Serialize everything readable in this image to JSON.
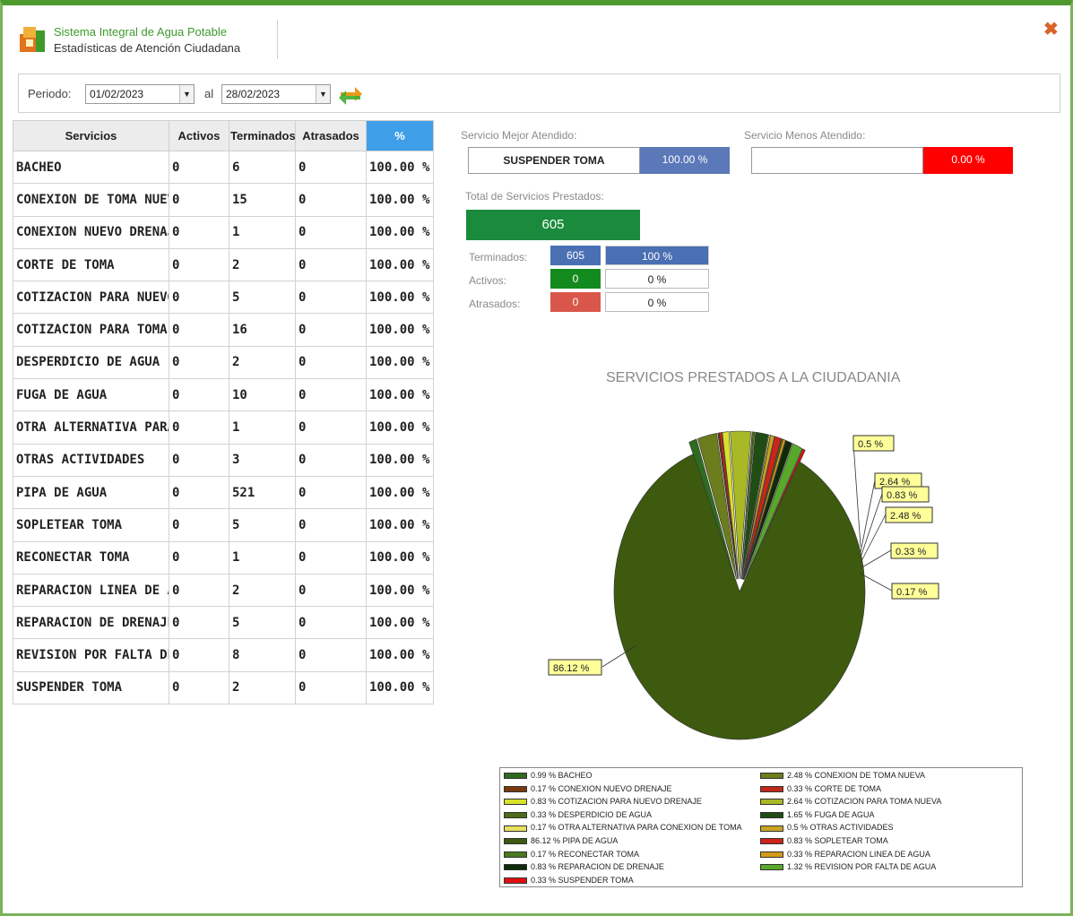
{
  "app": {
    "title": "Sistema Integral de Agua Potable",
    "subtitle": "Estadísticas de Atención Ciudadana"
  },
  "filter": {
    "periodo_label": "Periodo:",
    "from_date": "01/02/2023",
    "al_label": "al",
    "to_date": "28/02/2023"
  },
  "table": {
    "headers": [
      "Servicios",
      "Activos",
      "Terminados",
      "Atrasados",
      "%"
    ],
    "rows": [
      [
        "BACHEO",
        "0",
        "6",
        "0",
        "100.00 %"
      ],
      [
        "CONEXION DE TOMA NUEVA",
        "0",
        "15",
        "0",
        "100.00 %"
      ],
      [
        "CONEXION NUEVO DRENAJE",
        "0",
        "1",
        "0",
        "100.00 %"
      ],
      [
        "CORTE DE TOMA",
        "0",
        "2",
        "0",
        "100.00 %"
      ],
      [
        "COTIZACION PARA NUEVO DRENAJE",
        "0",
        "5",
        "0",
        "100.00 %"
      ],
      [
        "COTIZACION PARA TOMA NUEVA",
        "0",
        "16",
        "0",
        "100.00 %"
      ],
      [
        "DESPERDICIO DE AGUA",
        "0",
        "2",
        "0",
        "100.00 %"
      ],
      [
        "FUGA DE AGUA",
        "0",
        "10",
        "0",
        "100.00 %"
      ],
      [
        "OTRA ALTERNATIVA PARA CONEXION DE TOMA",
        "0",
        "1",
        "0",
        "100.00 %"
      ],
      [
        "OTRAS ACTIVIDADES",
        "0",
        "3",
        "0",
        "100.00 %"
      ],
      [
        "PIPA DE AGUA",
        "0",
        "521",
        "0",
        "100.00 %"
      ],
      [
        "SOPLETEAR TOMA",
        "0",
        "5",
        "0",
        "100.00 %"
      ],
      [
        "RECONECTAR TOMA",
        "0",
        "1",
        "0",
        "100.00 %"
      ],
      [
        "REPARACION LINEA DE AGUA",
        "0",
        "2",
        "0",
        "100.00 %"
      ],
      [
        "REPARACION DE DRENAJE",
        "0",
        "5",
        "0",
        "100.00 %"
      ],
      [
        "REVISION POR FALTA DE AGUA",
        "0",
        "8",
        "0",
        "100.00 %"
      ],
      [
        "SUSPENDER TOMA",
        "0",
        "2",
        "0",
        "100.00 %"
      ]
    ]
  },
  "stats": {
    "best_label": "Servicio Mejor Atendido:",
    "best_service": "SUSPENDER TOMA",
    "best_pct": "100.00 %",
    "worst_label": "Servicio Menos Atendido:",
    "worst_service": "",
    "worst_pct": "0.00 %",
    "total_label": "Total de Servicios Prestados:",
    "total_value": "605",
    "terminados_label": "Terminados:",
    "terminados_value": "605",
    "terminados_pct": "100 %",
    "activos_label": "Activos:",
    "activos_value": "0",
    "activos_pct": "0 %",
    "atrasados_label": "Atrasados:",
    "atrasados_value": "0",
    "atrasados_pct": "0 %"
  },
  "colors": {
    "frame_green": "#4f9a2f",
    "best_blue": "#5b78b8",
    "worst_red": "#ff0000",
    "total_green": "#1a8a3c",
    "activos_green": "#138a1e",
    "atrasados_red": "#d9574a",
    "terminados_blue": "#4a6fb3",
    "pct_header_blue": "#3f9ee8"
  },
  "chart_data": {
    "type": "pie",
    "title": "SERVICIOS PRESTADOS A LA CIUDADANIA",
    "series": [
      {
        "name": "BACHEO",
        "value": 0.99,
        "label": "0.99 % BACHEO",
        "color": "#2e6b1f"
      },
      {
        "name": "CONEXION DE TOMA NUEVA",
        "value": 2.48,
        "label": "2.48 % CONEXION DE TOMA NUEVA",
        "color": "#6b7d1c"
      },
      {
        "name": "CONEXION NUEVO DRENAJE",
        "value": 0.17,
        "label": "0.17 % CONEXION NUEVO DRENAJE",
        "color": "#7a3a10"
      },
      {
        "name": "CORTE DE TOMA",
        "value": 0.33,
        "label": "0.33 % CORTE DE TOMA",
        "color": "#c0281c"
      },
      {
        "name": "COTIZACION PARA NUEVO DRENAJE",
        "value": 0.83,
        "label": "0.83 % COTIZACION PARA NUEVO DRENAJE",
        "color": "#d8e02a"
      },
      {
        "name": "COTIZACION PARA TOMA NUEVA",
        "value": 2.64,
        "label": "2.64 % COTIZACION PARA TOMA NUEVA",
        "color": "#a9b825"
      },
      {
        "name": "DESPERDICIO DE AGUA",
        "value": 0.33,
        "label": "0.33 % DESPERDICIO DE AGUA",
        "color": "#4d6b1a"
      },
      {
        "name": "FUGA DE AGUA",
        "value": 1.65,
        "label": "1.65 % FUGA DE AGUA",
        "color": "#1f4d14"
      },
      {
        "name": "OTRA ALTERNATIVA PARA CONEXION DE TOMA",
        "value": 0.17,
        "label": "0.17 % OTRA ALTERNATIVA PARA CONEXION DE TOMA",
        "color": "#e8e060"
      },
      {
        "name": "OTRAS ACTIVIDADES",
        "value": 0.5,
        "label": "0.5 % OTRAS ACTIVIDADES",
        "color": "#c9a321"
      },
      {
        "name": "PIPA DE AGUA",
        "value": 86.12,
        "label": "86.12 % PIPA DE AGUA",
        "color": "#3d5a0e"
      },
      {
        "name": "SOPLETEAR TOMA",
        "value": 0.83,
        "label": "0.83 % SOPLETEAR TOMA",
        "color": "#cc2418"
      },
      {
        "name": "RECONECTAR TOMA",
        "value": 0.17,
        "label": "0.17 % RECONECTAR TOMA",
        "color": "#4a7a20"
      },
      {
        "name": "REPARACION LINEA DE AGUA",
        "value": 0.33,
        "label": "0.33 % REPARACION LINEA DE AGUA",
        "color": "#d49a16"
      },
      {
        "name": "REPARACION DE DRENAJE",
        "value": 0.83,
        "label": "0.83 % REPARACION DE DRENAJE",
        "color": "#0f2a08"
      },
      {
        "name": "REVISION POR FALTA DE AGUA",
        "value": 1.32,
        "label": "1.32 % REVISION POR FALTA DE AGUA",
        "color": "#5aa82a"
      },
      {
        "name": "SUSPENDER TOMA",
        "value": 0.33,
        "label": "0.33 % SUSPENDER TOMA",
        "color": "#e01010"
      }
    ],
    "visible_data_labels": [
      "0.5 %",
      "2.64 %",
      "0.83 %",
      "2.48 %",
      "0.33 %",
      "0.17 %",
      "86.12 %"
    ],
    "legend_position": "bottom"
  }
}
